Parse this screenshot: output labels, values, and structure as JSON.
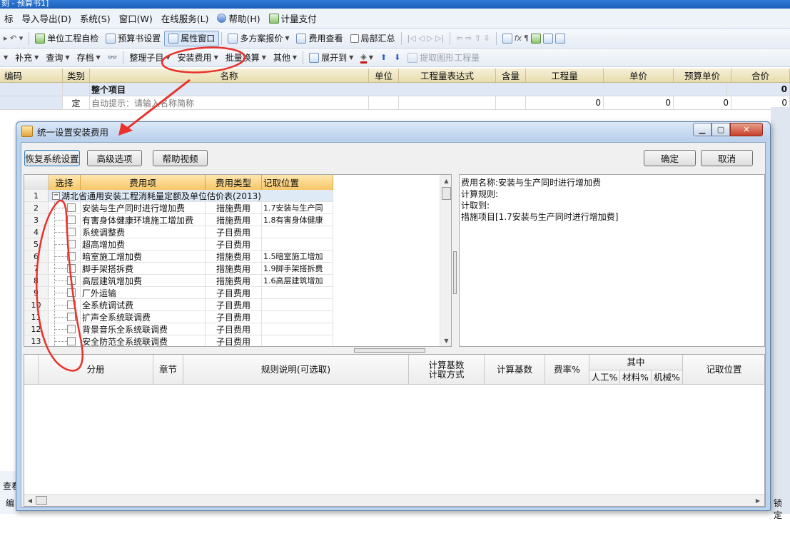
{
  "app": {
    "title_fragment": "刻 - 预算书1]"
  },
  "menu": [
    "标",
    "导入导出(D)",
    "系统(S)",
    "窗口(W)",
    "在线服务(L)",
    "帮助(H)",
    "计量支付"
  ],
  "toolbar1": [
    "单位工程自检",
    "预算书设置",
    "属性窗口",
    "多方案报价",
    "费用查看",
    "局部汇总"
  ],
  "toolbar2": [
    "补充",
    "查询",
    "存档",
    "整理子目",
    "安装费用",
    "批量换算",
    "其他",
    "展开到",
    "提取图形工程量"
  ],
  "grid": {
    "columns": [
      "编码",
      "类别",
      "名称",
      "单位",
      "工程量表达式",
      "含量",
      "工程量",
      "单价",
      "预算单价",
      "合价"
    ],
    "row1": {
      "name": "整个项目",
      "total": "0"
    },
    "row2": {
      "type": "定",
      "hint": "自动提示：请输入名称简称",
      "qty": "0",
      "price": "0",
      "budget": "0",
      "total": "0"
    }
  },
  "sidebar_fragments": {
    "bottom1": "查看",
    "bottom2": "编",
    "right": "锁定"
  },
  "dialog": {
    "title": "统一设置安装费用",
    "buttons": {
      "restore": "恢复系统设置",
      "advanced": "高级选项",
      "help_video": "帮助视频",
      "ok": "确定",
      "cancel": "取消"
    },
    "fee_table": {
      "headers": [
        "选择",
        "费用项",
        "费用类型",
        "记取位置"
      ],
      "group": {
        "num": "1",
        "name": "湖北省通用安装工程消耗量定额及单位估价表(2013)"
      },
      "rows": [
        {
          "num": "2",
          "name": "安装与生产同时进行增加费",
          "type": "措施费用",
          "loc": "1.7安装与生产同"
        },
        {
          "num": "3",
          "name": "有害身体健康环境施工增加费",
          "type": "措施费用",
          "loc": "1.8有害身体健康"
        },
        {
          "num": "4",
          "name": "系统调整费",
          "type": "子目费用",
          "loc": ""
        },
        {
          "num": "5",
          "name": "超高增加费",
          "type": "子目费用",
          "loc": ""
        },
        {
          "num": "6",
          "name": "暗室施工增加费",
          "type": "措施费用",
          "loc": "1.5暗室施工增加"
        },
        {
          "num": "7",
          "name": "脚手架搭拆费",
          "type": "措施费用",
          "loc": "1.9脚手架搭拆费"
        },
        {
          "num": "8",
          "name": "高层建筑增加费",
          "type": "措施费用",
          "loc": "1.6高层建筑增加"
        },
        {
          "num": "9",
          "name": "厂外运输",
          "type": "子目费用",
          "loc": ""
        },
        {
          "num": "10",
          "name": "全系统调试费",
          "type": "子目费用",
          "loc": ""
        },
        {
          "num": "11",
          "name": "扩声全系统联调费",
          "type": "子目费用",
          "loc": ""
        },
        {
          "num": "12",
          "name": "背景音乐全系统联调费",
          "type": "子目费用",
          "loc": ""
        },
        {
          "num": "13",
          "name": "安全防范全系统联调费",
          "type": "子目费用",
          "loc": ""
        }
      ]
    },
    "description": {
      "line1": "费用名称:安装与生产同时进行增加费",
      "line2": "计算规则:",
      "line3": "计取到:",
      "line4": "措施项目[1.7安装与生产同时进行增加费]"
    },
    "rule_table": {
      "fenche": "分册",
      "zhangjie": "章节",
      "rule": "规则说明(可选取)",
      "method_1": "计算基数",
      "method_2": "计取方式",
      "base": "计算基数",
      "rate": "费率%",
      "among": "其中",
      "labor": "人工%",
      "material": "材料%",
      "machine": "机械%",
      "position": "记取位置"
    }
  },
  "colors": {
    "annotation": "#e8322b",
    "header_orange": "#f7c768",
    "title_blue": "#1d5fb8"
  }
}
